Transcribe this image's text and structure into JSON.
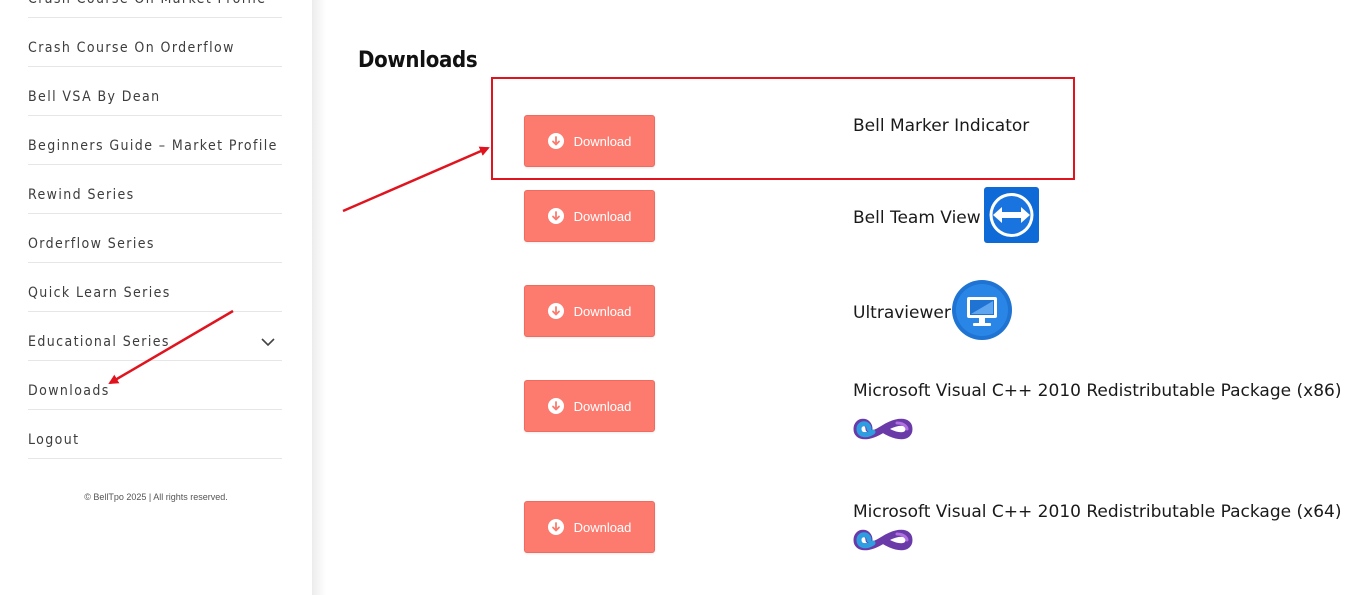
{
  "sidebar": {
    "items": [
      {
        "label": "Crash Course On Market Profile"
      },
      {
        "label": "Crash Course On Orderflow"
      },
      {
        "label": "Bell VSA By Dean"
      },
      {
        "label": "Beginners Guide – Market Profile"
      },
      {
        "label": "Rewind Series"
      },
      {
        "label": "Orderflow Series"
      },
      {
        "label": "Quick Learn Series"
      },
      {
        "label": "Educational Series",
        "expandable": true
      },
      {
        "label": "Downloads"
      },
      {
        "label": "Logout"
      }
    ],
    "copyright": "© BellTpo 2025 | All rights reserved."
  },
  "main": {
    "title": "Downloads",
    "downloads": [
      {
        "button_label": "Download",
        "name": "Bell Marker Indicator"
      },
      {
        "button_label": "Download",
        "name": "Bell Team View",
        "icon": "teamviewer-icon"
      },
      {
        "button_label": "Download",
        "name": "Ultraviewer",
        "icon": "ultraviewer-icon"
      },
      {
        "button_label": "Download",
        "name": "Microsoft Visual C++ 2010 Redistributable Package (x86)",
        "icon": "visual-studio-icon"
      },
      {
        "button_label": "Download",
        "name": "Microsoft Visual C++ 2010 Redistributable Package (x64)",
        "icon": "visual-studio-icon"
      }
    ]
  },
  "colors": {
    "button": "#fc7b6e",
    "annotation": "#e0141e",
    "teamviewer": "#0e6ad6",
    "ultraviewer": "#1f73d2"
  }
}
